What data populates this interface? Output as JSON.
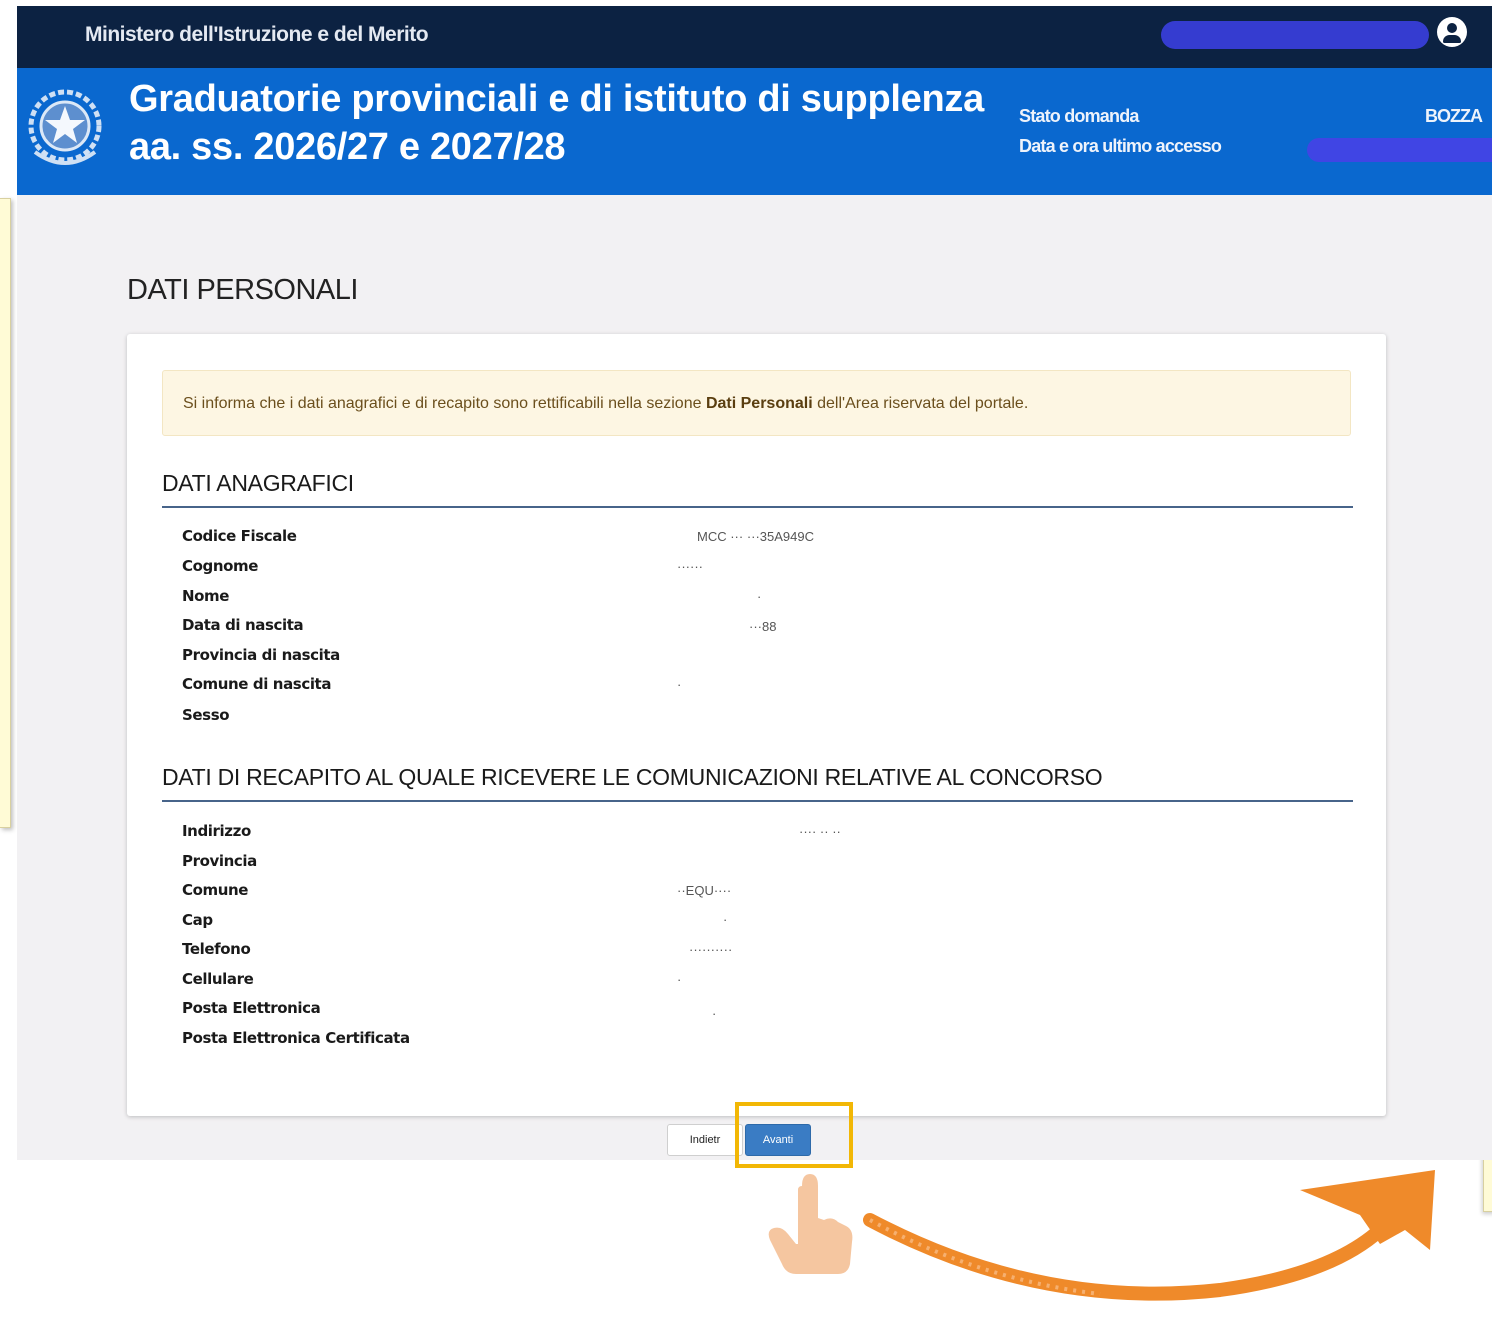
{
  "header": {
    "ministry": "Ministero dell'Istruzione e del Merito",
    "title_line1": "Graduatorie provinciali e di istituto di supplenza",
    "title_line2": "aa. ss. 2026/27 e 2027/28",
    "stato_label": "Stato domanda",
    "stato_value": "BOZZA",
    "accesso_label": "Data e ora ultimo accesso"
  },
  "page": {
    "heading": "DATI PERSONALI",
    "alert_before": "Si informa che i dati anagrafici e di recapito sono rettificabili nella sezione ",
    "alert_bold": "Dati Personali",
    "alert_after": " dell'Area riservata del portale."
  },
  "anagrafici": {
    "title": "DATI ANAGRAFICI",
    "fields": [
      {
        "label": "Codice Fiscale",
        "value": "MCC ··· ···35A949C"
      },
      {
        "label": "Cognome",
        "value": "······"
      },
      {
        "label": "Nome",
        "value": "·"
      },
      {
        "label": "Data di nascita",
        "value": "···88"
      },
      {
        "label": "Provincia di nascita",
        "value": ""
      },
      {
        "label": "Comune di nascita",
        "value": "·"
      },
      {
        "label": "Sesso",
        "value": ""
      }
    ]
  },
  "recapito": {
    "title": "DATI DI RECAPITO AL QUALE RICEVERE LE COMUNICAZIONI RELATIVE AL CONCORSO",
    "fields": [
      {
        "label": "Indirizzo",
        "value": "···· ·· ··"
      },
      {
        "label": "Provincia",
        "value": ""
      },
      {
        "label": "Comune",
        "value": "··EQU····"
      },
      {
        "label": "Cap",
        "value": "·"
      },
      {
        "label": "Telefono",
        "value": "··········"
      },
      {
        "label": "Cellulare",
        "value": "·"
      },
      {
        "label": "Posta Elettronica",
        "value": "·"
      },
      {
        "label": "Posta Elettronica Certificata",
        "value": ""
      }
    ]
  },
  "buttons": {
    "back": "Indietr",
    "next": "Avanti"
  },
  "colors": {
    "topbar": "#0c2242",
    "banner": "#0a68cf",
    "highlight": "#f2b705",
    "arrow": "#ef8a2a",
    "next_button": "#3a7cc4"
  }
}
